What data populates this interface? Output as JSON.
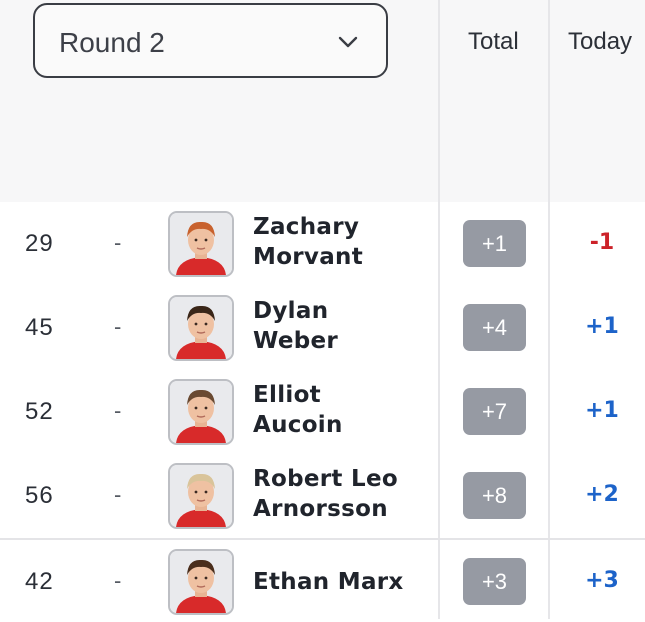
{
  "round_select": {
    "value": "Round 2"
  },
  "columns": {
    "total": "Total",
    "today": "Today"
  },
  "colors": {
    "under_par": "#cc2229",
    "over_par": "#1d63c9",
    "badge": "#969aa3"
  },
  "rows": [
    {
      "pos": "29",
      "move": "-",
      "name_line1": "Zachary",
      "name_line2": "Morvant",
      "total": "+1",
      "today": "-1",
      "today_status": "under_par",
      "hair": "#c8622e"
    },
    {
      "pos": "45",
      "move": "-",
      "name_line1": "Dylan",
      "name_line2": "Weber",
      "total": "+4",
      "today": "+1",
      "today_status": "over_par",
      "hair": "#3a2618"
    },
    {
      "pos": "52",
      "move": "-",
      "name_line1": "Elliot",
      "name_line2": "Aucoin",
      "total": "+7",
      "today": "+1",
      "today_status": "over_par",
      "hair": "#6a4a32"
    },
    {
      "pos": "56",
      "move": "-",
      "name_line1": "Robert Leo",
      "name_line2": "Arnorsson",
      "total": "+8",
      "today": "+2",
      "today_status": "over_par",
      "hair": "#d9c49a"
    },
    {
      "pos": "42",
      "move": "-",
      "name_line1": "Ethan Marx",
      "name_line2": "",
      "total": "+3",
      "today": "+3",
      "today_status": "over_par",
      "hair": "#4a2e1c"
    }
  ]
}
